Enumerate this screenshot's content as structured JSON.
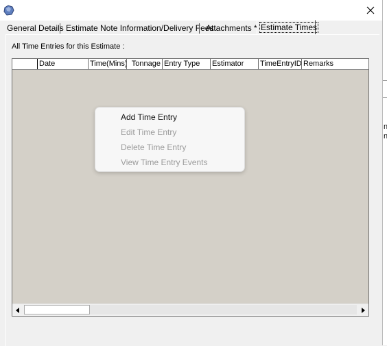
{
  "dialog": {
    "tabs": [
      {
        "label": "General Details",
        "active": false
      },
      {
        "label": "Estimate Note Information/Delivery Fees",
        "active": false
      },
      {
        "label": "Attachments *",
        "active": false
      },
      {
        "label": "Estimate Times",
        "active": true
      }
    ],
    "caption": "All Time Entries for this Estimate :",
    "grid": {
      "columns": [
        "",
        "Date",
        "Time(Mins)",
        "Tonnage",
        "Entry Type",
        "Estimator",
        "TimeEntryID",
        "Remarks"
      ],
      "rows": []
    }
  },
  "context_menu": {
    "items": [
      {
        "label": "Add Time Entry",
        "enabled": true
      },
      {
        "label": "Edit Time Entry",
        "enabled": false
      },
      {
        "label": "Delete Time Entry",
        "enabled": false
      },
      {
        "label": "View Time Entry Events",
        "enabled": false
      }
    ]
  },
  "background_fragments": [
    "n",
    "n"
  ],
  "colors": {
    "grid_bg": "#d4d0c8",
    "disabled_text": "#9b9b9b",
    "dialog_bg": "#f0f0f0"
  },
  "icons": {
    "app": "app-icon",
    "close": "close-icon",
    "scroll_left": "arrow-left-icon",
    "scroll_right": "arrow-right-icon"
  }
}
